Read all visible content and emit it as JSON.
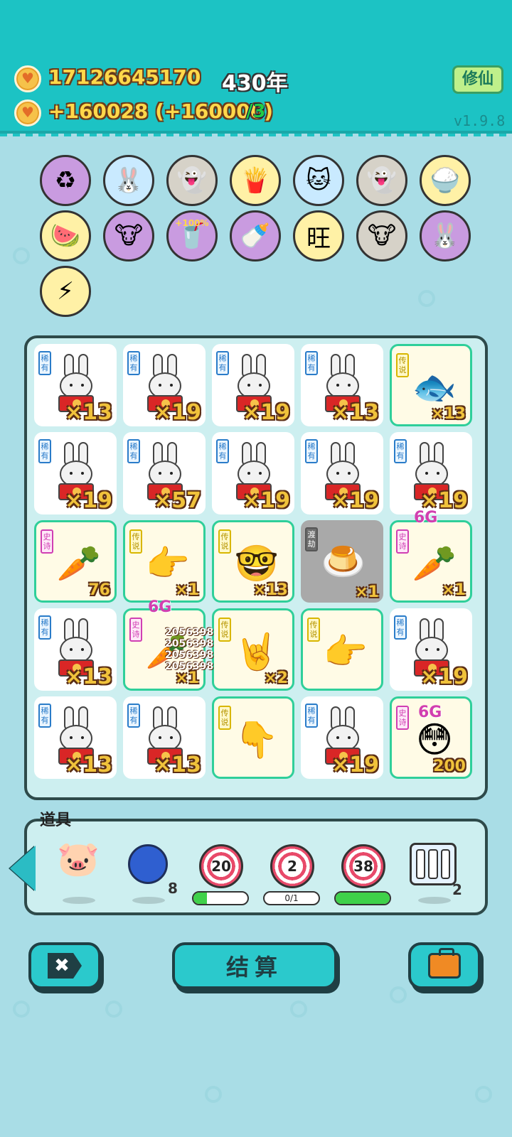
{
  "header": {
    "coins": "17126645170",
    "year": "430年",
    "income": "+160028 (+160000)",
    "income_suffix": "/3",
    "mode_button": "修仙",
    "version": "v1.9.8"
  },
  "buffs": [
    {
      "icon": "recycle-icon",
      "glyph": "♻",
      "bg": "#c99be0"
    },
    {
      "icon": "bunny-icon",
      "glyph": "🐰",
      "bg": "#c9eaff"
    },
    {
      "icon": "ghost-icon",
      "glyph": "👻",
      "bg": "#d6d2c8"
    },
    {
      "icon": "fries-icon",
      "glyph": "🍟",
      "bg": "#fff1a6"
    },
    {
      "icon": "cat-icon",
      "glyph": "🐱",
      "bg": "#c9eaff"
    },
    {
      "icon": "ghost-wink-icon",
      "glyph": "👻",
      "bg": "#d6d2c8"
    },
    {
      "icon": "rice-bowl-icon",
      "glyph": "🍚",
      "bg": "#fff1a6"
    },
    {
      "icon": "fruit-bowl-icon",
      "glyph": "🍉",
      "bg": "#fff1a6"
    },
    {
      "icon": "cow-pair-icon",
      "glyph": "🐮",
      "bg": "#c99be0"
    },
    {
      "icon": "boba-icon",
      "glyph": "🥤",
      "bg": "#c99be0",
      "text": "+100%"
    },
    {
      "icon": "bottle-icon",
      "glyph": "🍼",
      "bg": "#c99be0"
    },
    {
      "icon": "wang-text-icon",
      "glyph": "旺",
      "bg": "#fff1a6"
    },
    {
      "icon": "cow-pair-icon",
      "glyph": "🐮",
      "bg": "#d6d2c8"
    },
    {
      "icon": "bunny-icon",
      "glyph": "🐰",
      "bg": "#c99be0"
    },
    {
      "icon": "lightning-icon",
      "glyph": "⚡",
      "bg": "#fff1a6"
    }
  ],
  "board": [
    [
      {
        "tag": "稀有",
        "type": "rare",
        "art": "bunny",
        "count": "×13"
      },
      {
        "tag": "稀有",
        "type": "rare",
        "art": "bunny",
        "count": "×19"
      },
      {
        "tag": "稀有",
        "type": "rare",
        "art": "bunny",
        "count": "×19"
      },
      {
        "tag": "稀有",
        "type": "rare",
        "art": "bunny",
        "count": "×13"
      },
      {
        "tag": "传说",
        "type": "legend",
        "art": "🐟",
        "count": "×13"
      }
    ],
    [
      {
        "tag": "稀有",
        "type": "rare",
        "art": "bunny",
        "count": "×19"
      },
      {
        "tag": "稀有",
        "type": "rare",
        "art": "bunny",
        "count": "×57"
      },
      {
        "tag": "稀有",
        "type": "rare",
        "art": "bunny",
        "count": "×19"
      },
      {
        "tag": "稀有",
        "type": "rare",
        "art": "bunny",
        "count": "×19"
      },
      {
        "tag": "稀有",
        "type": "rare",
        "art": "bunny",
        "count": "×19"
      }
    ],
    [
      {
        "tag": "史诗",
        "type": "epic",
        "art": "🥕",
        "count": "76"
      },
      {
        "tag": "传说",
        "type": "legend",
        "art": "👉",
        "count": "×1"
      },
      {
        "tag": "传说",
        "type": "legend",
        "art": "🤓",
        "count": "×13"
      },
      {
        "tag": "渡劫",
        "type": "grey",
        "art": "🍮",
        "count": "×1"
      },
      {
        "tag": "史诗",
        "type": "epic",
        "art": "🥕",
        "count": "×1"
      }
    ],
    [
      {
        "tag": "稀有",
        "type": "rare",
        "art": "bunny",
        "count": "×13"
      },
      {
        "tag": "史诗",
        "type": "epic",
        "art": "🥕",
        "count": "×1"
      },
      {
        "tag": "传说",
        "type": "legend",
        "art": "🤘",
        "count": "×2"
      },
      {
        "tag": "传说",
        "type": "legend",
        "art": "👉",
        "count": ""
      },
      {
        "tag": "稀有",
        "type": "rare",
        "art": "bunny",
        "count": "×19"
      }
    ],
    [
      {
        "tag": "稀有",
        "type": "rare",
        "art": "bunny",
        "count": "×13"
      },
      {
        "tag": "稀有",
        "type": "rare",
        "art": "bunny",
        "count": "×13"
      },
      {
        "tag": "传说",
        "type": "legend",
        "art": "👇",
        "count": ""
      },
      {
        "tag": "稀有",
        "type": "rare",
        "art": "bunny",
        "count": "×19"
      },
      {
        "tag": "史诗",
        "type": "epic",
        "art": "😳",
        "count": "200"
      }
    ]
  ],
  "floating": {
    "tier_label": "6G",
    "popups": [
      "2056398",
      "2056398",
      "2056398",
      "2056398"
    ]
  },
  "tools": {
    "title": "道具",
    "blueberry_count": "8",
    "targets": [
      {
        "value": "20",
        "bar_text": "",
        "progress": 0.25
      },
      {
        "value": "2",
        "bar_text": "0/1",
        "progress": 0
      },
      {
        "value": "38",
        "bar_text": "",
        "progress": 1.0
      }
    ],
    "shelf_count": "2"
  },
  "buttons": {
    "settle": "结算"
  }
}
